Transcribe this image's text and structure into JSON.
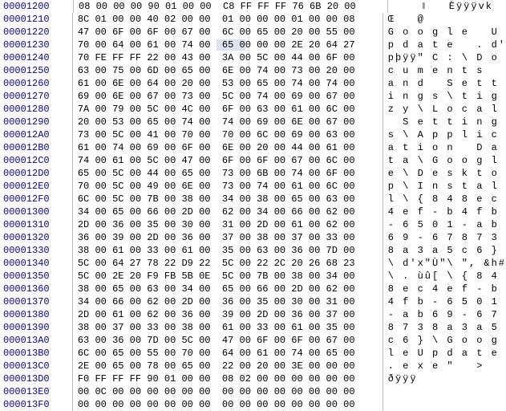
{
  "rows": [
    {
      "offset": "00001200",
      "hex": "08 00 00 00 90 01 00 00  C8 FF FF FF 76 6B 20 00",
      "ascii": "    ‖   Èÿÿÿvk "
    },
    {
      "offset": "00001210",
      "hex": "8C 01 00 00 40 02 00 00  01 00 00 00 01 00 00 08",
      "ascii": "Œ   @           "
    },
    {
      "offset": "00001220",
      "hex": "47 00 6F 00 6F 00 67 00  6C 00 65 00 20 00 55 00",
      "ascii": "G o o g l e   U "
    },
    {
      "offset": "00001230",
      "hex": "70 00 64 00 61 00 74 00  65 00 00 00 2E 20 64 27",
      "ascii": "p d a t e   . d'",
      "hl": [
        24,
        29
      ]
    },
    {
      "offset": "00001240",
      "hex": "70 FE FF FF 22 00 43 00  3A 00 5C 00 44 00 6F 00",
      "ascii": "pþÿÿ\" C : \\ D o "
    },
    {
      "offset": "00001250",
      "hex": "63 00 75 00 6D 00 65 00  6E 00 74 00 73 00 20 00",
      "ascii": "c u m e n t s   "
    },
    {
      "offset": "00001260",
      "hex": "61 00 6E 00 64 00 20 00  53 00 65 00 74 00 74 00",
      "ascii": "a n d   S e t t "
    },
    {
      "offset": "00001270",
      "hex": "69 00 6E 00 67 00 73 00  5C 00 74 00 69 00 67 00",
      "ascii": "i n g s \\ t i g "
    },
    {
      "offset": "00001280",
      "hex": "7A 00 79 00 5C 00 4C 00  6F 00 63 00 61 00 6C 00",
      "ascii": "z y \\ L o c a l "
    },
    {
      "offset": "00001290",
      "hex": "20 00 53 00 65 00 74 00  74 00 69 00 6E 00 67 00",
      "ascii": "  S e t t i n g "
    },
    {
      "offset": "000012A0",
      "hex": "73 00 5C 00 41 00 70 00  70 00 6C 00 69 00 63 00",
      "ascii": "s \\ A p p l i c "
    },
    {
      "offset": "000012B0",
      "hex": "61 00 74 00 69 00 6F 00  6E 00 20 00 44 00 61 00",
      "ascii": "a t i o n   D a "
    },
    {
      "offset": "000012C0",
      "hex": "74 00 61 00 5C 00 47 00  6F 00 6F 00 67 00 6C 00",
      "ascii": "t a \\ G o o g l "
    },
    {
      "offset": "000012D0",
      "hex": "65 00 5C 00 44 00 65 00  73 00 6B 00 74 00 6F 00",
      "ascii": "e \\ D e s k t o "
    },
    {
      "offset": "000012E0",
      "hex": "70 00 5C 00 49 00 6E 00  73 00 74 00 61 00 6C 00",
      "ascii": "p \\ I n s t a l "
    },
    {
      "offset": "000012F0",
      "hex": "6C 00 5C 00 7B 00 38 00  34 00 38 00 65 00 63 00",
      "ascii": "l \\ { 8 4 8 e c "
    },
    {
      "offset": "00001300",
      "hex": "34 00 65 00 66 00 2D 00  62 00 34 00 66 00 62 00",
      "ascii": "4 e f - b 4 f b "
    },
    {
      "offset": "00001310",
      "hex": "2D 00 36 00 35 00 30 00  31 00 2D 00 61 00 62 00",
      "ascii": "- 6 5 0 1 - a b "
    },
    {
      "offset": "00001320",
      "hex": "36 00 39 00 2D 00 36 00  37 00 38 00 37 00 33 00",
      "ascii": "6 9 - 6 7 8 7 3 "
    },
    {
      "offset": "00001330",
      "hex": "38 00 61 00 33 00 61 00  35 00 63 00 36 00 7D 00",
      "ascii": "8 a 3 a 5 c 6 } "
    },
    {
      "offset": "00001340",
      "hex": "5C 00 64 27 78 22 D9 22  5C 00 22 2C 20 26 68 23",
      "ascii": "\\ d'x\"Ù\"\\ \", &h#"
    },
    {
      "offset": "00001350",
      "hex": "5C 00 2E 20 F9 FB 5B 0E  5C 00 7B 00 38 00 34 00",
      "ascii": "\\ . ùû[ \\ { 8 4 "
    },
    {
      "offset": "00001360",
      "hex": "38 00 65 00 63 00 34 00  65 00 66 00 2D 00 62 00",
      "ascii": "8 e c 4 e f - b "
    },
    {
      "offset": "00001370",
      "hex": "34 00 66 00 62 00 2D 00  36 00 35 00 30 00 31 00",
      "ascii": "4 f b - 6 5 0 1 "
    },
    {
      "offset": "00001380",
      "hex": "2D 00 61 00 62 00 36 00  39 00 2D 00 36 00 37 00",
      "ascii": "- a b 6 9 - 6 7 "
    },
    {
      "offset": "00001390",
      "hex": "38 00 37 00 33 00 38 00  61 00 33 00 61 00 35 00",
      "ascii": "8 7 3 8 a 3 a 5 "
    },
    {
      "offset": "000013A0",
      "hex": "63 00 36 00 7D 00 5C 00  47 00 6F 00 6F 00 67 00",
      "ascii": "c 6 } \\ G o o g "
    },
    {
      "offset": "000013B0",
      "hex": "6C 00 65 00 55 00 70 00  64 00 61 00 74 00 65 00",
      "ascii": "l e U p d a t e "
    },
    {
      "offset": "000013C0",
      "hex": "2E 00 65 00 78 00 65 00  22 00 20 00 3E 00 00 00",
      "ascii": ". e x e \"   >   "
    },
    {
      "offset": "000013D0",
      "hex": "F0 FF FF FF 90 01 00 00  08 02 00 00 00 00 00 00",
      "ascii": "ðÿÿÿ            "
    },
    {
      "offset": "000013E0",
      "hex": "00 0C 00 00 00 00 00 00  00 00 00 00 00 00 00 00",
      "ascii": "                "
    },
    {
      "offset": "000013F0",
      "hex": "00 00 00 00 00 00 00 00  00 00 00 00 00 00 00 00",
      "ascii": "                "
    }
  ]
}
